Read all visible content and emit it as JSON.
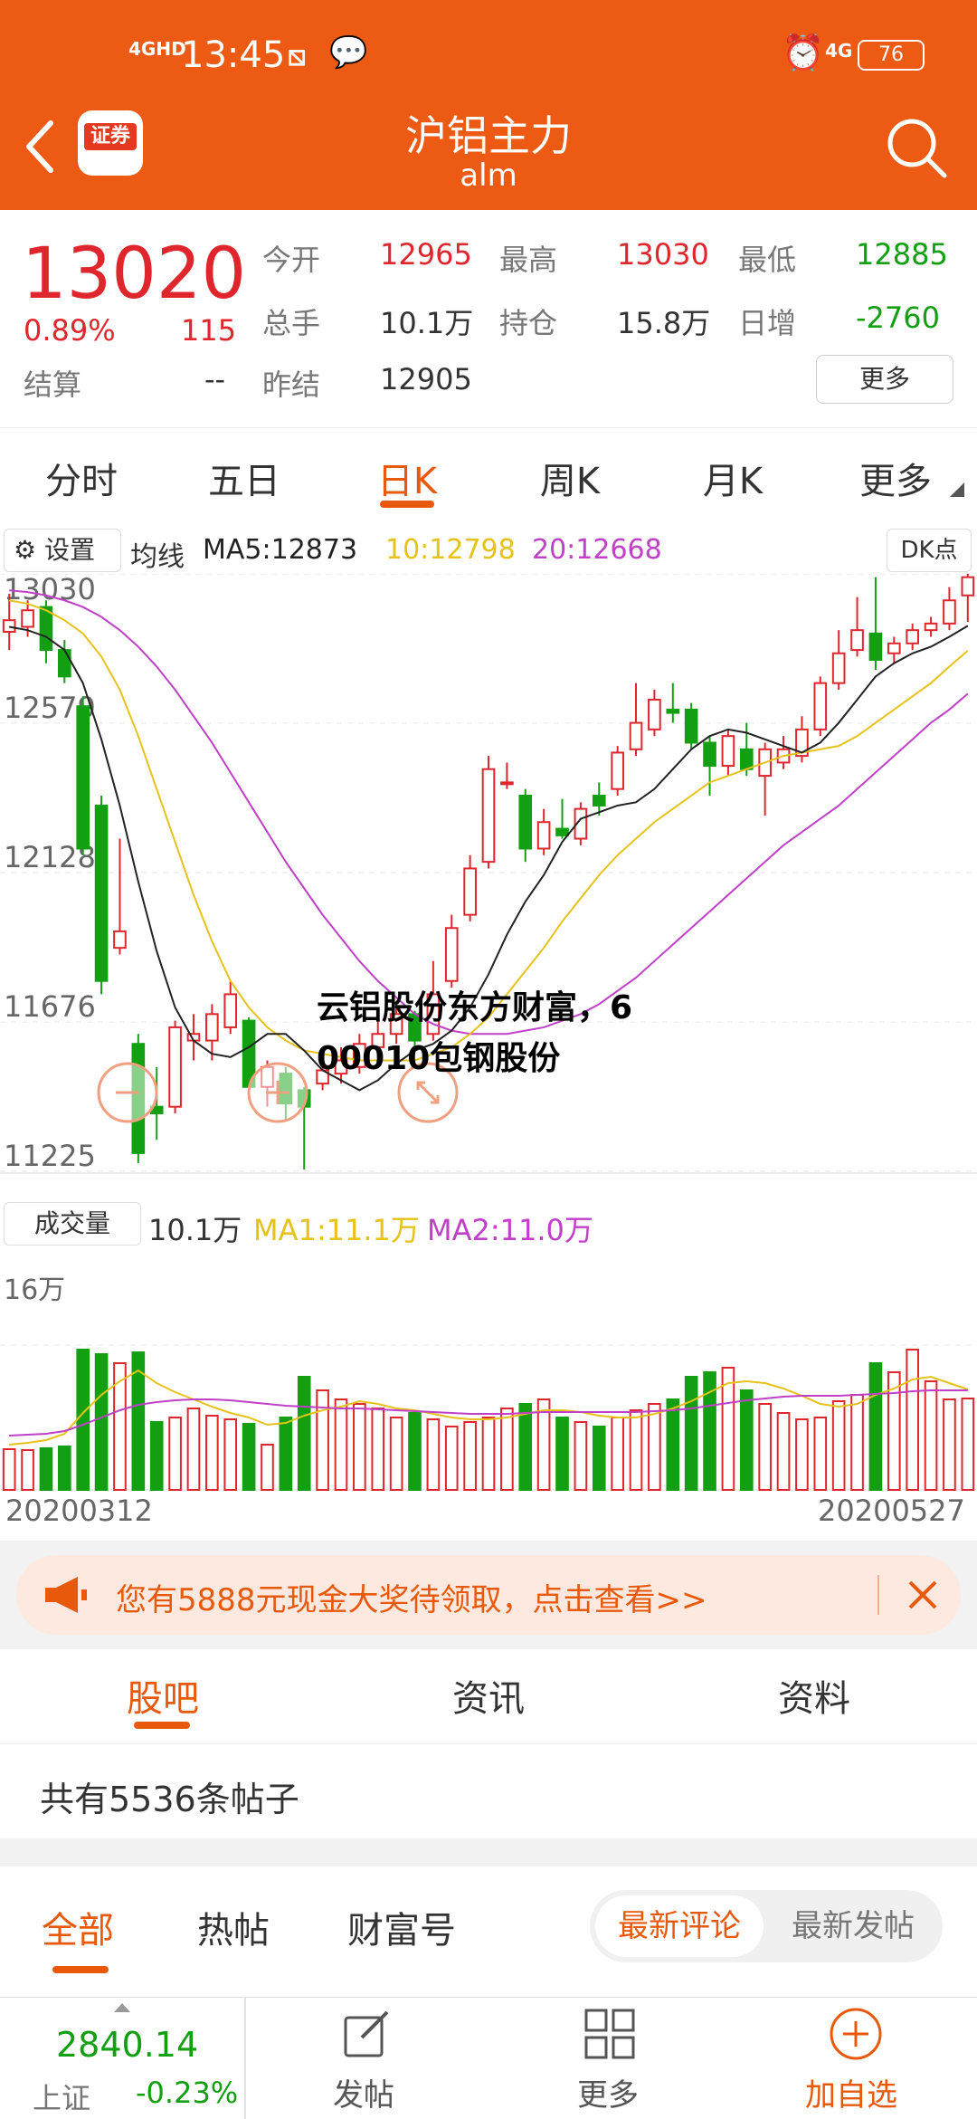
{
  "status_bar": {
    "signal": "4GHD",
    "time": "13:45",
    "network": "4G",
    "battery": "76"
  },
  "header": {
    "app_badge": "证券",
    "title": "沪铝主力",
    "subtitle": "alm"
  },
  "quote": {
    "price": "13020",
    "change_pct": "0.89%",
    "change": "115",
    "settle_label": "结算",
    "settle_value": "--",
    "open_label": "今开",
    "open_value": "12965",
    "high_label": "最高",
    "high_value": "13030",
    "low_label": "最低",
    "low_value": "12885",
    "volume_label": "总手",
    "volume_value": "10.1万",
    "oi_label": "持仓",
    "oi_value": "15.8万",
    "daily_inc_label": "日增",
    "daily_inc_value": "-2760",
    "prev_settle_label": "昨结",
    "prev_settle_value": "12905",
    "more_button": "更多"
  },
  "period_tabs": [
    "分时",
    "五日",
    "日K",
    "周K",
    "月K",
    "更多"
  ],
  "chart": {
    "settings_label": "设置",
    "ma_title": "均线",
    "ma5": "MA5:12873",
    "ma10": "10:12798",
    "ma20": "20:12668",
    "dk_button": "DK点",
    "volume_label": "成交量",
    "volume_value": "10.1万",
    "vol_ma1": "MA1:11.1万",
    "vol_ma2": "MA2:11.0万",
    "vol_tick": "16万",
    "start_date": "20200312",
    "end_date": "20200527",
    "overlay_text_line1": "云铝股份东方财富，6",
    "overlay_text_line2": "00010包钢股份"
  },
  "chart_data": {
    "type": "candlestick",
    "y_ticks": [
      13030,
      12579,
      12128,
      11676,
      11225
    ],
    "ylim": [
      11225,
      13030
    ],
    "vol_ylim": [
      0,
      160000
    ],
    "dates_visible": [
      "20200312",
      "20200527"
    ],
    "colors": {
      "up": "#e0262d",
      "down": "#12a012",
      "ma5": "#222222",
      "ma10": "#e6c21a",
      "ma20": "#c040c8"
    },
    "candles": [
      {
        "o": 12855,
        "c": 12890,
        "h": 12970,
        "l": 12800
      },
      {
        "o": 12870,
        "c": 12920,
        "h": 12950,
        "l": 12840
      },
      {
        "o": 12930,
        "c": 12800,
        "h": 12950,
        "l": 12760
      },
      {
        "o": 12800,
        "c": 12720,
        "h": 12830,
        "l": 12700
      },
      {
        "o": 12630,
        "c": 12200,
        "h": 12660,
        "l": 12180
      },
      {
        "o": 12330,
        "c": 11800,
        "h": 12360,
        "l": 11760
      },
      {
        "o": 11900,
        "c": 11950,
        "h": 12230,
        "l": 11880
      },
      {
        "o": 11610,
        "c": 11280,
        "h": 11640,
        "l": 11250
      },
      {
        "o": 11420,
        "c": 11400,
        "h": 11540,
        "l": 11320
      },
      {
        "o": 11420,
        "c": 11660,
        "h": 11680,
        "l": 11400
      },
      {
        "o": 11620,
        "c": 11640,
        "h": 11700,
        "l": 11560
      },
      {
        "o": 11620,
        "c": 11700,
        "h": 11730,
        "l": 11560
      },
      {
        "o": 11660,
        "c": 11760,
        "h": 11800,
        "l": 11640
      },
      {
        "o": 11680,
        "c": 11480,
        "h": 11690,
        "l": 11460
      },
      {
        "o": 11480,
        "c": 11540,
        "h": 11560,
        "l": 11420
      },
      {
        "o": 11520,
        "c": 11430,
        "h": 11540,
        "l": 11380
      },
      {
        "o": 11470,
        "c": 11420,
        "h": 11480,
        "l": 11230
      },
      {
        "o": 11490,
        "c": 11530,
        "h": 11560,
        "l": 11470
      },
      {
        "o": 11520,
        "c": 11560,
        "h": 11600,
        "l": 11490
      },
      {
        "o": 11540,
        "c": 11610,
        "h": 11640,
        "l": 11520
      },
      {
        "o": 11600,
        "c": 11640,
        "h": 11680,
        "l": 11570
      },
      {
        "o": 11640,
        "c": 11700,
        "h": 11720,
        "l": 11610
      },
      {
        "o": 11700,
        "c": 11620,
        "h": 11710,
        "l": 11600
      },
      {
        "o": 11640,
        "c": 11760,
        "h": 11860,
        "l": 11620
      },
      {
        "o": 11800,
        "c": 11960,
        "h": 12000,
        "l": 11780
      },
      {
        "o": 12000,
        "c": 12140,
        "h": 12180,
        "l": 11980
      },
      {
        "o": 12160,
        "c": 12440,
        "h": 12480,
        "l": 12140
      },
      {
        "o": 12400,
        "c": 12400,
        "h": 12460,
        "l": 12380
      },
      {
        "o": 12360,
        "c": 12200,
        "h": 12380,
        "l": 12160
      },
      {
        "o": 12200,
        "c": 12280,
        "h": 12320,
        "l": 12180
      },
      {
        "o": 12260,
        "c": 12240,
        "h": 12350,
        "l": 12230
      },
      {
        "o": 12230,
        "c": 12320,
        "h": 12340,
        "l": 12210
      },
      {
        "o": 12360,
        "c": 12330,
        "h": 12400,
        "l": 12300
      },
      {
        "o": 12380,
        "c": 12490,
        "h": 12510,
        "l": 12360
      },
      {
        "o": 12500,
        "c": 12580,
        "h": 12700,
        "l": 12480
      },
      {
        "o": 12560,
        "c": 12650,
        "h": 12680,
        "l": 12540
      },
      {
        "o": 12620,
        "c": 12610,
        "h": 12700,
        "l": 12580
      },
      {
        "o": 12620,
        "c": 12520,
        "h": 12640,
        "l": 12500
      },
      {
        "o": 12520,
        "c": 12450,
        "h": 12540,
        "l": 12360
      },
      {
        "o": 12450,
        "c": 12540,
        "h": 12560,
        "l": 12420
      },
      {
        "o": 12500,
        "c": 12440,
        "h": 12580,
        "l": 12420
      },
      {
        "o": 12420,
        "c": 12500,
        "h": 12520,
        "l": 12300
      },
      {
        "o": 12460,
        "c": 12500,
        "h": 12540,
        "l": 12440
      },
      {
        "o": 12480,
        "c": 12560,
        "h": 12600,
        "l": 12460
      },
      {
        "o": 12560,
        "c": 12700,
        "h": 12720,
        "l": 12540
      },
      {
        "o": 12700,
        "c": 12790,
        "h": 12860,
        "l": 12680
      },
      {
        "o": 12800,
        "c": 12860,
        "h": 12960,
        "l": 12780
      },
      {
        "o": 12850,
        "c": 12770,
        "h": 13020,
        "l": 12740
      },
      {
        "o": 12790,
        "c": 12820,
        "h": 12840,
        "l": 12760
      },
      {
        "o": 12820,
        "c": 12860,
        "h": 12880,
        "l": 12800
      },
      {
        "o": 12860,
        "c": 12880,
        "h": 12900,
        "l": 12840
      },
      {
        "o": 12880,
        "c": 12950,
        "h": 12990,
        "l": 12860
      },
      {
        "o": 12965,
        "c": 13020,
        "h": 13030,
        "l": 12885
      }
    ],
    "ma5": [
      12870,
      12860,
      12840,
      12800,
      12700,
      12530,
      12330,
      12100,
      11890,
      11720,
      11620,
      11580,
      11570,
      11600,
      11640,
      11640,
      11590,
      11530,
      11500,
      11470,
      11500,
      11550,
      11590,
      11610,
      11650,
      11720,
      11820,
      11940,
      12040,
      12120,
      12220,
      12290,
      12310,
      12330,
      12340,
      12380,
      12440,
      12500,
      12540,
      12560,
      12550,
      12530,
      12510,
      12490,
      12520,
      12580,
      12650,
      12720,
      12760,
      12790,
      12810,
      12840,
      12873
    ],
    "ma10": [
      12950,
      12940,
      12920,
      12890,
      12850,
      12780,
      12680,
      12540,
      12380,
      12220,
      12060,
      11920,
      11800,
      11720,
      11660,
      11620,
      11590,
      11580,
      11570,
      11560,
      11560,
      11560,
      11560,
      11580,
      11600,
      11640,
      11690,
      11760,
      11830,
      11900,
      11980,
      12050,
      12120,
      12180,
      12230,
      12280,
      12320,
      12360,
      12400,
      12420,
      12440,
      12460,
      12480,
      12490,
      12500,
      12510,
      12540,
      12580,
      12620,
      12660,
      12700,
      12750,
      12798
    ],
    "ma20": [
      12980,
      12975,
      12965,
      12950,
      12930,
      12900,
      12860,
      12810,
      12750,
      12680,
      12600,
      12520,
      12430,
      12340,
      12250,
      12160,
      12080,
      12000,
      11930,
      11860,
      11800,
      11750,
      11700,
      11670,
      11650,
      11640,
      11640,
      11640,
      11650,
      11660,
      11680,
      11700,
      11730,
      11770,
      11810,
      11860,
      11910,
      11960,
      12010,
      12060,
      12110,
      12160,
      12210,
      12250,
      12290,
      12330,
      12380,
      12430,
      12480,
      12530,
      12580,
      12620,
      12668
    ],
    "volumes": [
      45000,
      44000,
      46000,
      48000,
      155000,
      150000,
      140000,
      152000,
      75000,
      80000,
      90000,
      82000,
      78000,
      73000,
      50000,
      80000,
      125000,
      110000,
      100000,
      95000,
      90000,
      80000,
      85000,
      78000,
      70000,
      75000,
      80000,
      90000,
      95000,
      100000,
      80000,
      75000,
      70000,
      80000,
      88000,
      95000,
      100000,
      125000,
      130000,
      135000,
      110000,
      95000,
      85000,
      78000,
      80000,
      98000,
      105000,
      140000,
      130000,
      155000,
      120000,
      100000,
      101000
    ],
    "vol_ma1": [
      50000,
      52000,
      55000,
      62000,
      85000,
      105000,
      120000,
      132000,
      118000,
      108000,
      100000,
      92000,
      85000,
      80000,
      72000,
      74000,
      82000,
      88000,
      92000,
      98000,
      95000,
      90000,
      88000,
      84000,
      80000,
      78000,
      78000,
      80000,
      84000,
      88000,
      88000,
      86000,
      82000,
      80000,
      80000,
      84000,
      90000,
      98000,
      108000,
      118000,
      120000,
      118000,
      112000,
      104000,
      95000,
      92000,
      95000,
      105000,
      112000,
      122000,
      125000,
      118000,
      111000
    ],
    "vol_ma2": [
      60000,
      61000,
      62000,
      65000,
      72000,
      80000,
      88000,
      94000,
      97000,
      99000,
      100000,
      100000,
      99000,
      97000,
      95000,
      93000,
      92000,
      91000,
      90000,
      90000,
      89000,
      88000,
      87000,
      86000,
      85000,
      84000,
      84000,
      84000,
      85000,
      86000,
      86000,
      86000,
      86000,
      86000,
      86000,
      87000,
      88000,
      90000,
      93000,
      96000,
      99000,
      101000,
      103000,
      104000,
      104000,
      104000,
      105000,
      106000,
      107000,
      109000,
      110000,
      110000,
      110000
    ]
  },
  "banner": {
    "text": "您有5888元现金大奖待领取，点击查看>>"
  },
  "section_tabs": [
    "股吧",
    "资讯",
    "资料"
  ],
  "posts": {
    "count_text": "共有5536条帖子"
  },
  "filters": {
    "tabs": [
      "全部",
      "热帖",
      "财富号"
    ],
    "sort_options": [
      "最新评论",
      "最新发帖"
    ]
  },
  "bottom_bar": {
    "index_value": "2840.14",
    "index_name": "上证",
    "index_change": "-0.23%",
    "post_label": "发帖",
    "more_label": "更多",
    "add_label": "加自选"
  }
}
